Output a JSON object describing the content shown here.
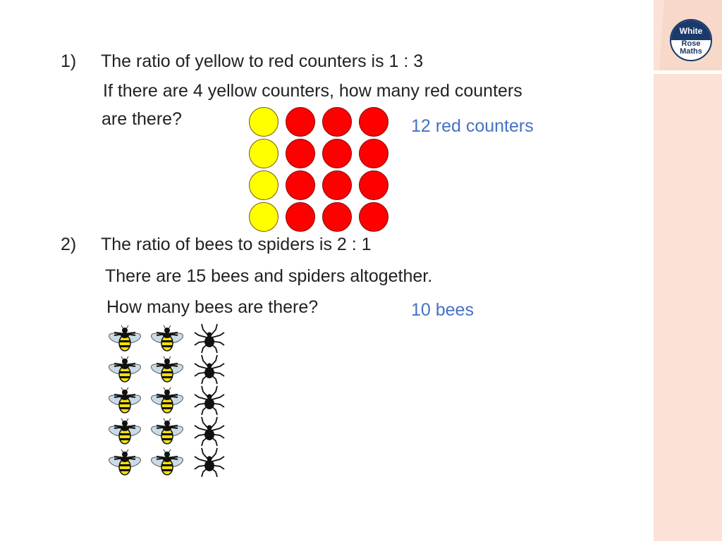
{
  "branding": {
    "logo_lines": [
      "White",
      "Rose",
      "Maths"
    ]
  },
  "questions": [
    {
      "number": "1)",
      "lines": [
        "The ratio of yellow to red counters is 1 : 3",
        "If there are 4 yellow counters, how many red counters",
        "are there?"
      ],
      "answer": "12 red counters",
      "counters": {
        "rows": 4,
        "yellow_per_row": 1,
        "red_per_row": 3,
        "colors": {
          "yellow": "#ffff00",
          "red": "#ff0000"
        }
      }
    },
    {
      "number": "2)",
      "lines": [
        "The ratio of bees to spiders is 2 : 1",
        "There are 15 bees and spiders altogether.",
        "How many bees are there?"
      ],
      "answer": "10 bees",
      "creatures": {
        "rows": 5,
        "bees_per_row": 2,
        "spiders_per_row": 1
      }
    }
  ],
  "colors": {
    "answer": "#4472c4",
    "sidebar": "#fbe1d6"
  }
}
